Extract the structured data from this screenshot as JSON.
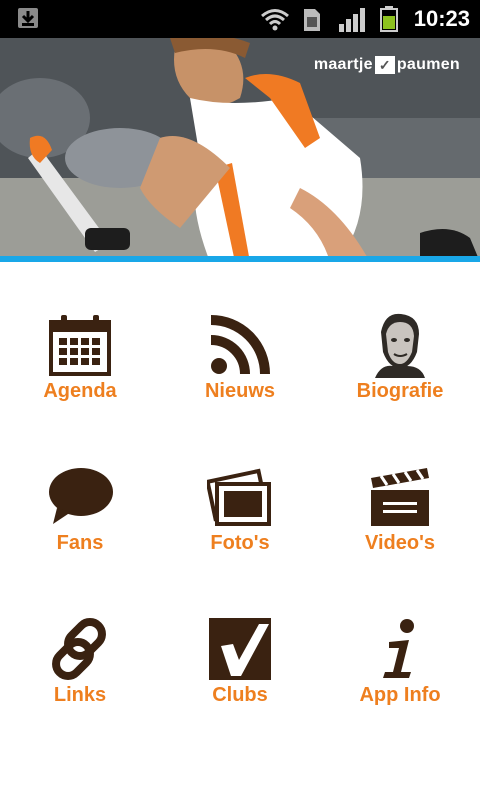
{
  "status_bar": {
    "time": "10:23",
    "icons": [
      "download-icon",
      "wifi-icon",
      "sim-icon",
      "signal-icon",
      "battery-icon"
    ]
  },
  "banner": {
    "brand": {
      "left": "maartje",
      "right": "paumen"
    }
  },
  "colors": {
    "label": "#ee7f1f",
    "icon": "#3a2211",
    "accent_bar": "#19a7e8"
  },
  "menu": [
    {
      "label": "Agenda",
      "icon": "calendar-icon"
    },
    {
      "label": "Nieuws",
      "icon": "rss-icon"
    },
    {
      "label": "Biografie",
      "icon": "portrait-icon"
    },
    {
      "label": "Fans",
      "icon": "speech-bubble-icon"
    },
    {
      "label": "Foto's",
      "icon": "photos-icon"
    },
    {
      "label": "Video's",
      "icon": "clapperboard-icon"
    },
    {
      "label": "Links",
      "icon": "link-icon"
    },
    {
      "label": "Clubs",
      "icon": "clubs-icon"
    },
    {
      "label": "App Info",
      "icon": "info-icon"
    }
  ]
}
